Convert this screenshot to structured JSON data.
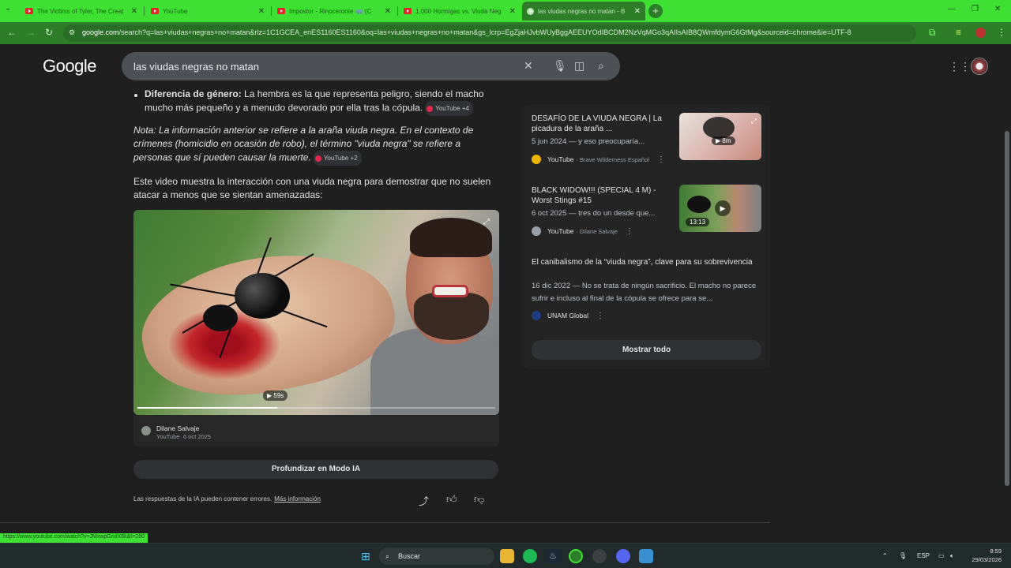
{
  "browser": {
    "tabs": [
      {
        "title": "The Victims of Tyler, The Creat",
        "active": false
      },
      {
        "title": "YouTube",
        "active": false
      },
      {
        "title": "Impostor - Rinoceronte 🦏 (C",
        "active": false
      },
      {
        "title": "1,000 Hormigas vs. Viuda Neg",
        "active": false
      },
      {
        "title": "las viudas negras no matan - B",
        "active": true
      }
    ],
    "new_tab": "+",
    "url_domain": "google.com",
    "url_rest": "/search?q=las+viudas+negras+no+matan&rlz=1C1GCEA_enES1160ES1160&oq=las+viudas+negras+no+matan&gs_lcrp=EgZjaHJvbWUyBggAEEUYOdIBCDM2NzVqMGo3qAIIsAIB8QWmfdymG6GtMg&sourceid=chrome&ie=UTF-8",
    "status_url": "https://www.youtube.com/watch?v=JMxwpGndX6k&t=280"
  },
  "google": {
    "logo": "Google",
    "query": "las viudas negras no matan"
  },
  "ai_overview": {
    "bullet_label": "Diferencia de género:",
    "bullet_text": " La hembra es la que representa peligro, siendo el macho mucho más pequeño y a menudo devorado por ella tras la cópula.",
    "bullet_chip": "YouTube +4",
    "note_text": "Nota: La información anterior se refiere a la araña viuda negra. En el contexto de crímenes (homicidio en ocasión de robo), el término \"viuda negra\" se refiere a personas que sí pueden causar la muerte.",
    "note_chip": "YouTube +2",
    "video_intro": "Este video muestra la interacción con una viuda negra para demostrar que no suelen atacar a menos que se sientan amenazadas:",
    "video": {
      "duration": "▶ 59s",
      "channel": "Dilane Salvaje",
      "sub": "YouTube· 6 oct 2025",
      "progress": 0.39
    },
    "deep_button": "Profundizar en Modo IA",
    "disclaimer": "Las respuestas de la IA pueden contener errores.",
    "disclaimer_link": "Más información"
  },
  "side_results": [
    {
      "title": "DESAFÍO DE LA VIUDA NEGRA | La picadura de la araña ...",
      "snippet": "5 jun 2024 — y eso preocuparía...",
      "source": "YouTube",
      "source_sub": "· Brave Wilderness Español",
      "duration": "▶ 8m"
    },
    {
      "title": "BLACK WIDOW!!! (SPECIAL 4 M) - Worst Stings #15",
      "snippet": "6 oct 2025 — tres do un desde que...",
      "source": "YouTube",
      "source_sub": "· Dilane Salvaje",
      "duration": "13:13"
    },
    {
      "title": "El canibalismo de la “viuda negra”, clave para su sobrevivencia",
      "snippet": "16 dic 2022 — No se trata de ningún sacrificio. El macho no parece sufrir e incluso al final de la cópula se ofrece para se...",
      "source": "UNAM Global",
      "source_sub": ""
    }
  ],
  "show_all": "Mostrar todo",
  "taskbar": {
    "search_label": "Buscar",
    "lang": "ESP",
    "time": "8:59",
    "date": "29/03/2026"
  },
  "colors": {
    "tab_strip": "#3ee034",
    "toolbar": "#2d7d29",
    "page_bg": "#1f1f1f"
  }
}
